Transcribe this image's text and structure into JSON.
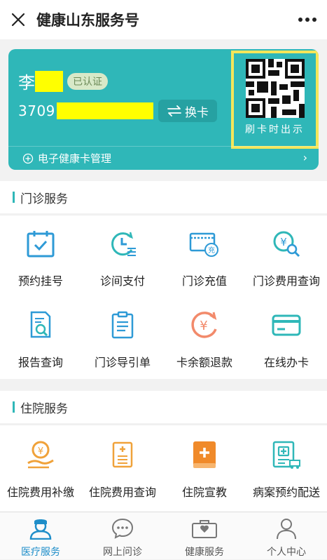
{
  "app": {
    "title": "健康山东服务号"
  },
  "card": {
    "name_first": "李",
    "verified": "已认证",
    "id_prefix": "3709",
    "swap_label": "换卡",
    "qr_hint": "刷卡时出示",
    "manage_label": "电子健康卡管理"
  },
  "outpatient": {
    "title": "门诊服务",
    "items": [
      {
        "label": "预约挂号",
        "icon": "calendar-check-icon"
      },
      {
        "label": "诊间支付",
        "icon": "history-pay-icon"
      },
      {
        "label": "门诊充值",
        "icon": "card-recharge-icon"
      },
      {
        "label": "门诊费用查询",
        "icon": "fee-search-icon"
      },
      {
        "label": "报告查询",
        "icon": "report-search-icon"
      },
      {
        "label": "门诊导引单",
        "icon": "clipboard-icon"
      },
      {
        "label": "卡余额退款",
        "icon": "refund-icon"
      },
      {
        "label": "在线办卡",
        "icon": "card-icon"
      }
    ]
  },
  "inpatient": {
    "title": "住院服务",
    "items": [
      {
        "label": "住院费用补缴",
        "icon": "hand-coin-icon"
      },
      {
        "label": "住院费用查询",
        "icon": "bill-list-icon"
      },
      {
        "label": "住院宣教",
        "icon": "medical-book-icon"
      },
      {
        "label": "病案预约配送",
        "icon": "record-delivery-icon"
      }
    ]
  },
  "tabs": [
    {
      "label": "医疗服务",
      "icon": "doctor-icon",
      "active": true
    },
    {
      "label": "网上问诊",
      "icon": "chat-bubble-icon",
      "active": false
    },
    {
      "label": "健康服务",
      "icon": "health-kit-icon",
      "active": false
    },
    {
      "label": "个人中心",
      "icon": "user-icon",
      "active": false
    }
  ],
  "colors": {
    "teal": "#2fb7b8",
    "active_tab": "#1f8ec9",
    "highlight": "#ffff00",
    "qr_border": "#f4e65a",
    "orange": "#f08a2a"
  }
}
